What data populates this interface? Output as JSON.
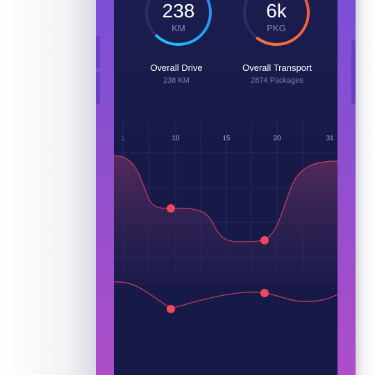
{
  "colors": {
    "frame_top": "#7a4fd8",
    "frame_bottom": "#b04ec8",
    "screen_bg": "#1b1d4f",
    "ring_drive_start": "#1fc8f4",
    "ring_drive_end": "#2d7ff0",
    "ring_transport_start": "#ff6a3a",
    "ring_transport_end": "#f2503c",
    "curve_stroke": "#c7405a",
    "marker": "#f0485a"
  },
  "stats": {
    "drive": {
      "value": "238",
      "unit": "KM",
      "title": "Overall Drive",
      "subtitle": "238 KM",
      "progress": 0.62
    },
    "transport": {
      "value": "6k",
      "unit": "PKG",
      "title": "Overall Transport",
      "subtitle": "2874 Packages",
      "progress": 0.6
    }
  },
  "chart": {
    "day_labels": [
      "1",
      "10",
      "15",
      "20",
      "31"
    ]
  }
}
